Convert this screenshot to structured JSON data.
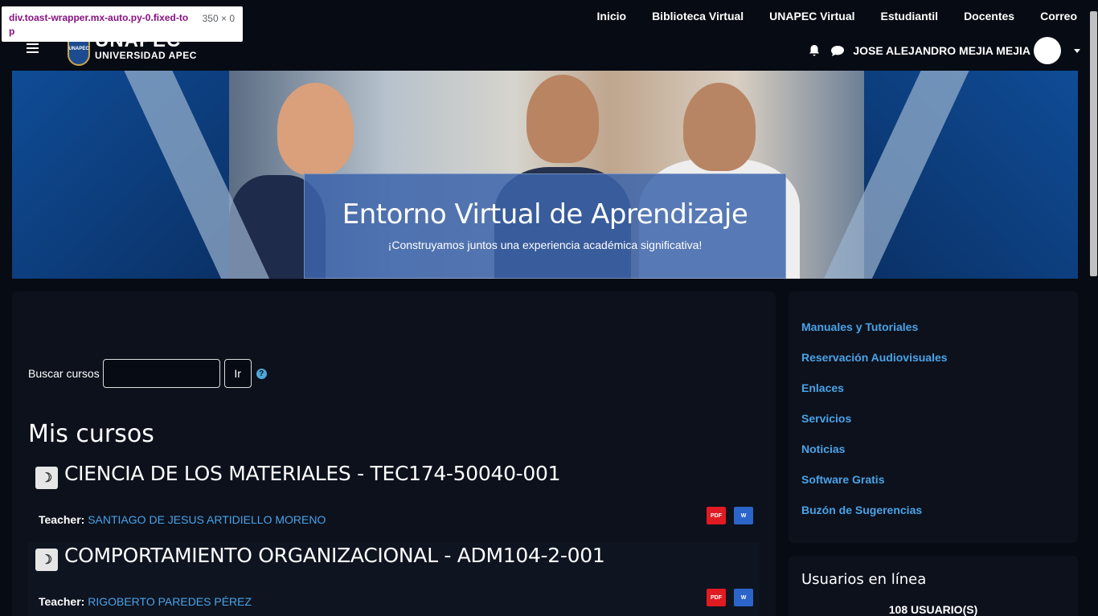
{
  "devtools_tooltip": {
    "selector": "div.toast-wrapper.mx-auto.py-0.fixed-top",
    "size": "350 × 0"
  },
  "nav": {
    "links": [
      "Inicio",
      "Biblioteca Virtual",
      "UNAPEC Virtual",
      "Estudiantil",
      "Docentes",
      "Correo"
    ]
  },
  "logo": {
    "name": "UNAPEC",
    "subtitle": "UNIVERSIDAD APEC",
    "seal_text": "UNAPEC"
  },
  "user": {
    "name": "JOSE ALEJANDRO MEJIA MEJIA"
  },
  "banner": {
    "title": "Entorno Virtual de Aprendizaje",
    "subtitle": "¡Construyamos juntos una experiencia académica significativa!"
  },
  "search": {
    "label": "Buscar cursos",
    "value": "",
    "button": "Ir",
    "help_icon": "?"
  },
  "courses_heading": "Mis cursos",
  "courses": [
    {
      "title": "CIENCIA DE LOS MATERIALES - TEC174-50040-001",
      "teacher_label": "Teacher:",
      "teacher": "SANTIAGO DE JESUS ARTIDIELLO MORENO"
    },
    {
      "title": "COMPORTAMIENTO ORGANIZACIONAL - ADM104-2-001",
      "teacher_label": "Teacher:",
      "teacher": "RIGOBERTO PAREDES PÉREZ"
    }
  ],
  "sidebar_links": [
    "Manuales y Tutoriales",
    "Reservación Audiovisuales",
    "Enlaces",
    "Servicios",
    "Noticias",
    "Software Gratis",
    "Buzón de Sugerencias"
  ],
  "online": {
    "title": "Usuarios en línea",
    "count": "108 USUARIO(S)"
  },
  "file_icons": {
    "pdf": "PDF",
    "word": "W"
  },
  "colors": {
    "background": "#070b14",
    "card": "#0c111c",
    "link": "#4aa3e8",
    "banner_box": "#3c64aa"
  }
}
